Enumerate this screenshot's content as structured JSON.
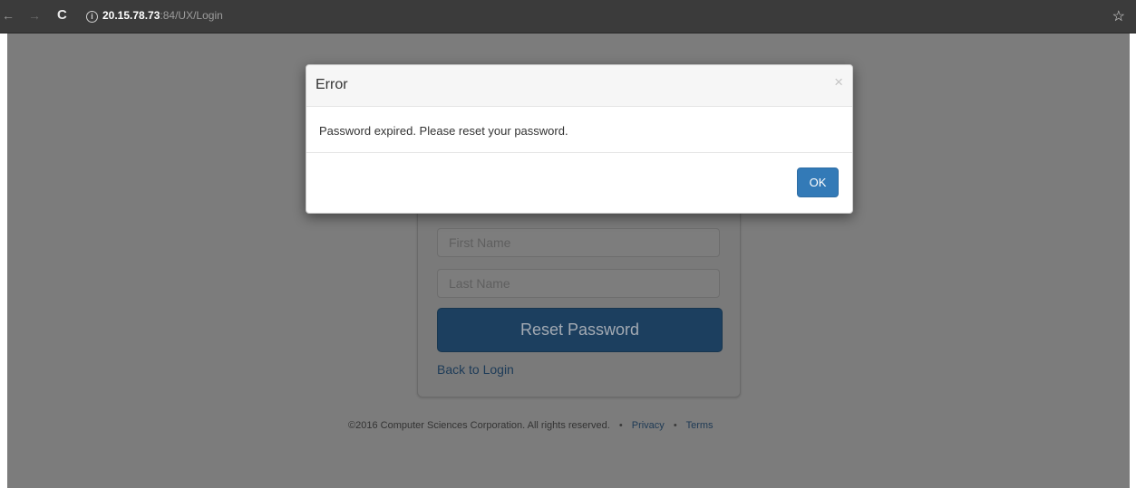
{
  "browser": {
    "url_host": "20.15.78.73",
    "url_path": ":84/UX/Login",
    "icons": [
      "back-icon",
      "forward-icon",
      "reload-icon",
      "info-icon",
      "star-icon"
    ]
  },
  "modal": {
    "title": "Error",
    "close_symbol": "×",
    "message": "Password expired. Please reset your password.",
    "ok_label": "OK",
    "accent_color": "#337ab7"
  },
  "reset_form": {
    "first_name_placeholder": "First Name",
    "last_name_placeholder": "Last Name",
    "reset_button_label": "Reset Password",
    "back_link": "Back to Login"
  },
  "footer": {
    "copyright": "©2016 Computer Sciences Corporation. All rights reserved.",
    "separator": "•",
    "privacy": "Privacy",
    "terms": "Terms"
  }
}
